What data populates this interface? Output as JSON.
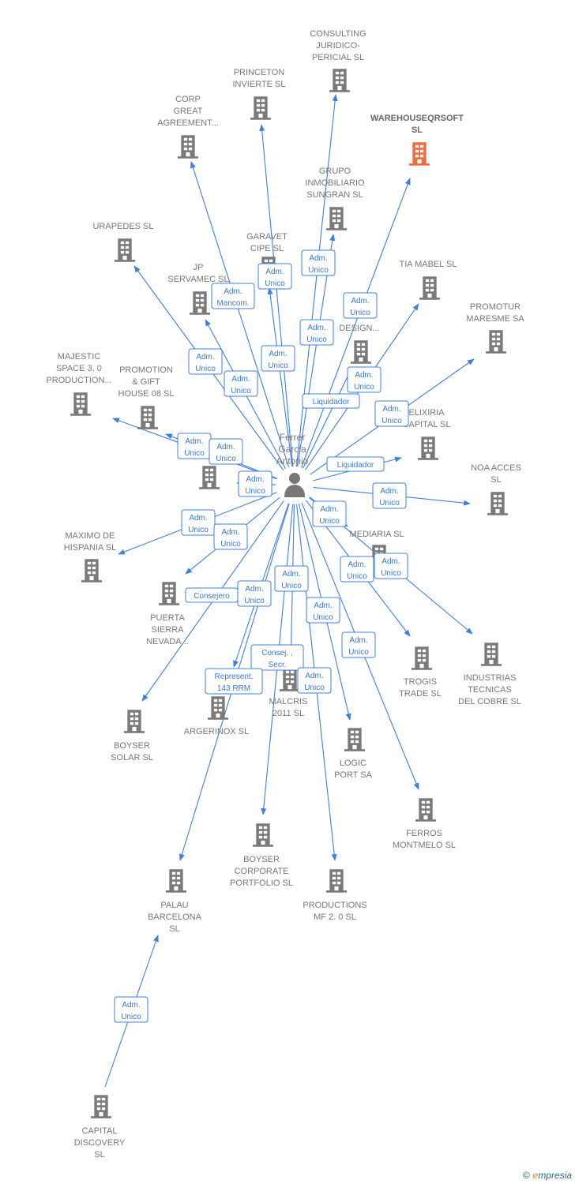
{
  "center": {
    "name_lines": [
      "Ferrer",
      "Garcia",
      "Antonio"
    ],
    "icon": "person-icon"
  },
  "colors": {
    "edge": "#3f7fdc",
    "node": "#7a7a7a",
    "highlight": "#f26b3a"
  },
  "nodes": [
    {
      "lines": [
        "CONSULTING",
        "JURIDICO-",
        "PERICIAL  SL"
      ]
    },
    {
      "lines": [
        "PRINCETON",
        "INVIERTE SL"
      ]
    },
    {
      "lines": [
        "CORP",
        "GREAT",
        "AGREEMENT..."
      ]
    },
    {
      "lines": [
        "WAREHOUSEQRSOFT",
        "SL"
      ],
      "highlight": true
    },
    {
      "lines": [
        "GRUPO",
        "INMOBILIARIO",
        "SUNGRAN SL"
      ]
    },
    {
      "lines": [
        "URAPEDES SL"
      ]
    },
    {
      "lines": [
        "GARAVET",
        "CIPE SL"
      ]
    },
    {
      "lines": [
        "TIA MABEL SL"
      ]
    },
    {
      "lines": [
        "JP",
        "SERVAMEC  SL"
      ]
    },
    {
      "lines": [
        "PROMOTUR",
        "MARESME SA"
      ]
    },
    {
      "lines": [
        "LA          &",
        "",
        "DESIGN..."
      ]
    },
    {
      "lines": [
        "MAJESTIC",
        "SPACE 3. 0",
        "PRODUCTION..."
      ]
    },
    {
      "lines": [
        "PROMOTION",
        "& GIFT",
        "HOUSE 08 SL"
      ]
    },
    {
      "lines": [
        "ELIXIRIA",
        "CAPITAL  SL"
      ]
    },
    {
      "lines": []
    },
    {
      "lines": [
        "NOA ACCES",
        "SL"
      ]
    },
    {
      "lines": [
        "MAXIMO DE",
        "HISPANIA  SL"
      ]
    },
    {
      "lines": [
        "MEDIARIA SL"
      ]
    },
    {
      "lines": [
        "PUERTA",
        "SIERRA",
        "NEVADA..."
      ]
    },
    {
      "lines": [
        "INDUSTRIAS",
        "TECNICAS",
        "DEL COBRE  SL"
      ]
    },
    {
      "lines": [
        "TROGIS",
        "TRADE SL"
      ]
    },
    {
      "lines": [
        "BOYSER",
        "SOLAR  SL"
      ]
    },
    {
      "lines": [
        "ARGERINOX SL"
      ]
    },
    {
      "lines": [
        "MALCRIS",
        "2011 SL"
      ]
    },
    {
      "lines": [
        "LOGIC",
        "PORT SA"
      ]
    },
    {
      "lines": [
        "FERROS",
        "MONTMELO  SL"
      ]
    },
    {
      "lines": [
        "BOYSER",
        "CORPORATE",
        "PORTFOLIO  SL"
      ]
    },
    {
      "lines": [
        "PRODUCTIONS",
        "MF 2. 0  SL"
      ]
    },
    {
      "lines": [
        "PALAU",
        "BARCELONA",
        "SL"
      ]
    },
    {
      "lines": [
        "CAPITAL",
        "DISCOVERY",
        "SL"
      ]
    }
  ],
  "badges": [
    [
      "Adm.",
      "Unico"
    ],
    [
      "Adm.",
      "Unico"
    ],
    [
      "Adm.",
      "Mancom."
    ],
    [
      "Adm.",
      "Unico"
    ],
    [
      "Adm.",
      "Unico"
    ],
    [
      "Adm.",
      "Unico"
    ],
    [
      "Adm.",
      "Unico"
    ],
    [
      "Adm.",
      "Unico"
    ],
    [
      "Adm.",
      "Unico"
    ],
    [
      "Liquidador"
    ],
    [
      "Adm.",
      "Unico"
    ],
    [
      "Adm.",
      "Unico"
    ],
    [
      "Adm.",
      "Unico"
    ],
    [
      "Adm.",
      "Unico"
    ],
    [
      "Liquidador"
    ],
    [
      "Adm.",
      "Unico"
    ],
    [
      "Adm.",
      "Unico"
    ],
    [
      "Adm.",
      "Unico"
    ],
    [
      "Adm.",
      "Unico"
    ],
    [
      "Adm.",
      "Unico"
    ],
    [
      "Adm.",
      "Unico"
    ],
    [
      "Adm.",
      "Unico"
    ],
    [
      "Consejero"
    ],
    [
      "Adm.",
      "Unico"
    ],
    [
      "Adm.",
      "Unico"
    ],
    [
      "Adm.",
      "Unico"
    ],
    [
      "Consej. ,",
      "Secr."
    ],
    [
      "Represent.",
      "143 RRM"
    ],
    [
      "Adm.",
      "Unico"
    ],
    [
      "Adm.",
      "Unico"
    ]
  ],
  "footer": {
    "copyright": "©",
    "brand": "mpresia",
    "brand_initial": "e"
  }
}
